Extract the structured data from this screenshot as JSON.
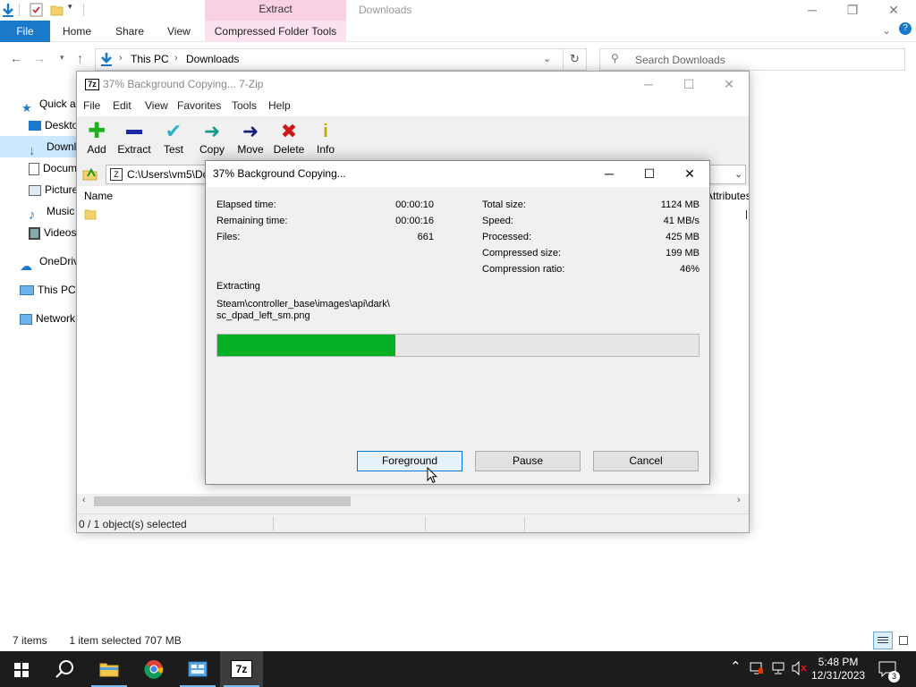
{
  "explorer": {
    "title": "Downloads",
    "contextual_tab_group": "Extract",
    "ribbon_tabs": [
      "File",
      "Home",
      "Share",
      "View",
      "Compressed Folder Tools"
    ],
    "breadcrumb": [
      "This PC",
      "Downloads"
    ],
    "search_placeholder": "Search Downloads",
    "nav_items": [
      "Quick access",
      "Desktop",
      "Downloads",
      "Documents",
      "Pictures",
      "Music",
      "Videos",
      "OneDrive",
      "This PC",
      "Network"
    ],
    "status_items": "7 items",
    "status_selected": "1 item selected  707 MB",
    "accent": "#1979ca"
  },
  "zip": {
    "title": "37% Background Copying... 7-Zip",
    "logo": "7z",
    "menu": [
      "File",
      "Edit",
      "View",
      "Favorites",
      "Tools",
      "Help"
    ],
    "toolbar": [
      "Add",
      "Extract",
      "Test",
      "Copy",
      "Move",
      "Delete",
      "Info"
    ],
    "path": "C:\\Users\\vm5\\Downloads\\",
    "col_name": "Name",
    "col_attributes": "Attributes",
    "status": "0 / 1 object(s) selected"
  },
  "dialog": {
    "title": "37% Background Copying...",
    "left_stats": [
      {
        "label": "Elapsed time:",
        "value": "00:00:10"
      },
      {
        "label": "Remaining time:",
        "value": "00:00:16"
      },
      {
        "label": "Files:",
        "value": "661"
      }
    ],
    "right_stats": [
      {
        "label": "Total size:",
        "value": "1124 MB"
      },
      {
        "label": "Speed:",
        "value": "41 MB/s"
      },
      {
        "label": "Processed:",
        "value": "425 MB"
      },
      {
        "label": "Compressed size:",
        "value": "199 MB"
      },
      {
        "label": "Compression ratio:",
        "value": "46%"
      }
    ],
    "operation": "Extracting",
    "current_file_line1": "Steam\\controller_base\\images\\api\\dark\\",
    "current_file_line2": "sc_dpad_left_sm.png",
    "progress_fraction": 0.37,
    "progress_color": "#06b025",
    "buttons": {
      "foreground": "Foreground",
      "pause": "Pause",
      "cancel": "Cancel"
    }
  },
  "taskbar": {
    "time": "5:48 PM",
    "date": "12/31/2023",
    "notification_count": "3",
    "apps": [
      "start-icon",
      "search-icon",
      "file-explorer-icon",
      "chrome-icon",
      "control-panel-icon",
      "7zip-icon"
    ]
  }
}
